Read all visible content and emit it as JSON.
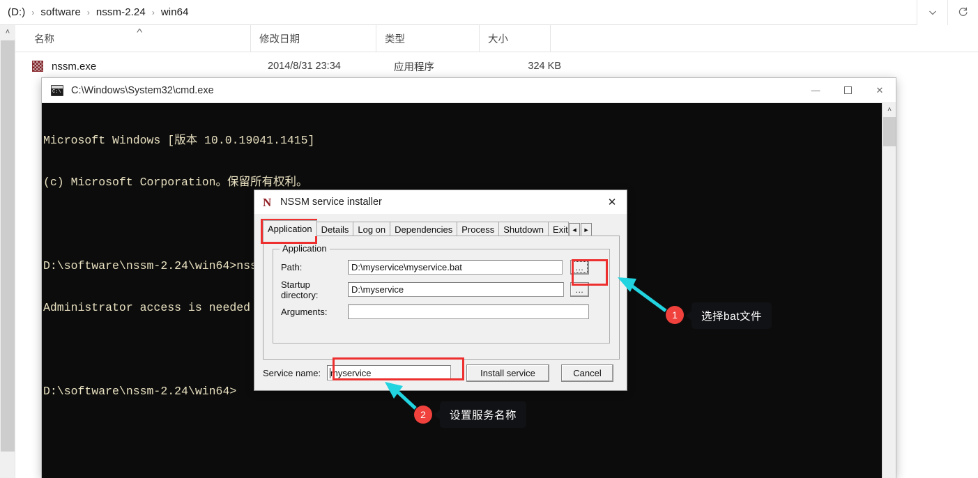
{
  "explorer": {
    "breadcrumb": {
      "items": [
        "(D:)",
        "software",
        "nssm-2.24",
        "win64"
      ],
      "separator": "›"
    },
    "address_buttons": {
      "dropdown": "∨",
      "refresh": "↻"
    },
    "columns": [
      {
        "label": "名称",
        "sorted": true,
        "sort_caret": "˄"
      },
      {
        "label": "修改日期"
      },
      {
        "label": "类型"
      },
      {
        "label": "大小"
      }
    ],
    "rows": [
      {
        "name": "nssm.exe",
        "date": "2014/8/31 23:34",
        "type": "应用程序",
        "size": "324 KB"
      }
    ],
    "scrollbar": {
      "up_arrow": "˄"
    }
  },
  "cmd_window": {
    "title": "C:\\Windows\\System32\\cmd.exe",
    "icon_label": "cmd-icon",
    "buttons": {
      "minimize": "—",
      "maximize": "☐",
      "close": "✕"
    },
    "scrollbar": {
      "up_arrow": "˄"
    },
    "console_lines": [
      "Microsoft Windows [版本 10.0.19041.1415]",
      "(c) Microsoft Corporation。保留所有权利。",
      "",
      "D:\\software\\nssm-2.24\\win64>nssm install myservice",
      "Administrator access is needed to install a service.",
      "",
      "D:\\software\\nssm-2.24\\win64>"
    ]
  },
  "nssm_dialog": {
    "title": "NSSM service installer",
    "logo": "N",
    "close": "✕",
    "tabs": [
      {
        "label": "Application",
        "active": true
      },
      {
        "label": "Details",
        "active": false
      },
      {
        "label": "Log on",
        "active": false
      },
      {
        "label": "Dependencies",
        "active": false
      },
      {
        "label": "Process",
        "active": false
      },
      {
        "label": "Shutdown",
        "active": false
      },
      {
        "label": "Exit",
        "active": false,
        "clipped": true
      }
    ],
    "tab_spinner": {
      "left": "◄",
      "right": "►"
    },
    "group": {
      "legend": "Application",
      "fields": [
        {
          "label": "Path:",
          "value": "D:\\myservice\\myservice.bat",
          "browse": "...",
          "placeholder": ""
        },
        {
          "label": "Startup directory:",
          "value": "D:\\myservice",
          "browse": "...",
          "placeholder": ""
        },
        {
          "label": "Arguments:",
          "value": "",
          "browse": "",
          "placeholder": ""
        }
      ]
    },
    "service_name": {
      "label": "Service name:",
      "value": "myservice",
      "placeholder": ""
    },
    "buttons": {
      "install": "Install service",
      "cancel": "Cancel"
    }
  },
  "annotations": {
    "highlight_color": "#ee2f2f",
    "arrow_color": "#22d3e0",
    "bubble_color": "#f0413c",
    "items": [
      {
        "number": "1",
        "text": "选择bat文件"
      },
      {
        "number": "2",
        "text": "设置服务名称"
      }
    ]
  }
}
